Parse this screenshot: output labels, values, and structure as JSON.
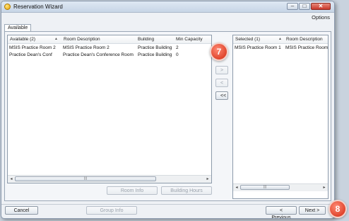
{
  "window": {
    "title": "Reservation Wizard",
    "options_label": "Options",
    "controls": {
      "minimize": "–",
      "maximize": "□",
      "close": "✕"
    }
  },
  "tab": {
    "label": "Available"
  },
  "available": {
    "columns": [
      "Available (2)",
      "Room Description",
      "Building",
      "Min Capacity"
    ],
    "rows": [
      [
        "MSIS Practice Room 2",
        "MSIS Practice Room 2",
        "Practice Building",
        "2"
      ],
      [
        "Practice Dean's Conf",
        "Practice Dean's Conference Room",
        "Practice Building",
        "0"
      ]
    ]
  },
  "selected": {
    "columns": [
      "Selected (1)",
      "Room Description"
    ],
    "rows": [
      [
        "MSIS Practice Room 1",
        "MSIS Practice Room"
      ]
    ]
  },
  "transfer": {
    "add_label": ">",
    "remove_label": "<",
    "remove_all_label": "<<"
  },
  "panel_buttons": {
    "room_info": "Room Info",
    "building_hours": "Building Hours"
  },
  "footer": {
    "cancel": "Cancel",
    "group_info": "Group Info",
    "previous": "< Previous",
    "next": "Next >"
  },
  "scroll": {
    "left_arrow": "◂",
    "right_arrow": "▸",
    "thumb_grip": "|||"
  },
  "sort_indicator": "▲",
  "callouts": {
    "step_7": "7",
    "step_8": "8"
  }
}
